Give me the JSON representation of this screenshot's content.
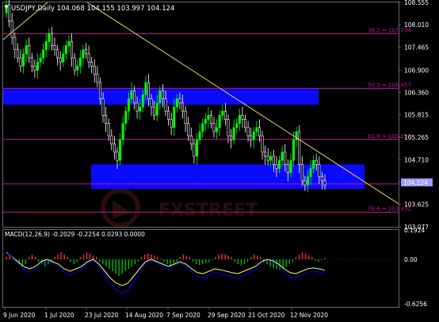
{
  "header": {
    "symbol_line": "USDJPY,Daily  104.068 104.155 103.997 104.124"
  },
  "price_axis": {
    "labels": [
      "108.555",
      "108.010",
      "107.465",
      "106.900",
      "106.360",
      "105.815",
      "105.265",
      "104.710",
      "104.170",
      "103.625",
      "103.077"
    ]
  },
  "current_price": "104.124",
  "macd_panel": {
    "title": "MACD(12,26,9) -0.2029 -0.2254 0.0293 0.0000",
    "axis_labels": [
      "0.1924",
      "0.00",
      "-0.6256"
    ]
  },
  "time_axis": {
    "labels": [
      "9 Jun 2020",
      "1 Jul 2020",
      "23 Jul 2020",
      "14 Aug 2020",
      "7 Sep 2020",
      "29 Sep 2020",
      "21 Oct 2020",
      "12 Nov 2020"
    ]
  },
  "fib_levels": [
    {
      "label": "38.2 = 107.794",
      "value": 107.794
    },
    {
      "label": "50.0 = 106.457",
      "value": 106.457
    },
    {
      "label": "61.8 = 105.211",
      "value": 105.211
    },
    {
      "label": "78.6 = 103.432",
      "value": 103.432
    }
  ],
  "zones": [
    {
      "name": "upper-zone",
      "from": 106.44,
      "to": 106.06
    },
    {
      "name": "lower-zone",
      "from": 104.6,
      "to": 104.0
    }
  ],
  "watermark": "FXSTREET",
  "colors": {
    "background": "#000000",
    "bull_candle": "#00ff00",
    "bear_candle": "#ffffff",
    "fib_line": "#c2179b",
    "zone": "#0a0aff",
    "trendline": "#e7d75a",
    "macd_pos": "#ff3030",
    "macd_neg": "#00c000",
    "signal_line": "#ffff60",
    "macd_line": "#0000ff",
    "axis_text": "#ffffff",
    "price_box": "#9a9aff"
  },
  "chart_data": {
    "type": "candlestick",
    "title": "USDJPY,Daily",
    "x": [
      "9 Jun 2020",
      "1 Jul 2020",
      "23 Jul 2020",
      "14 Aug 2020",
      "7 Sep 2020",
      "29 Sep 2020",
      "21 Oct 2020",
      "12 Nov 2020"
    ],
    "close_series": [
      108.5,
      108.1,
      107.7,
      107.4,
      107.2,
      107.0,
      107.3,
      107.5,
      107.2,
      107.0,
      106.9,
      107.1,
      107.2,
      107.4,
      107.6,
      107.8,
      107.5,
      107.4,
      107.2,
      107.1,
      107.3,
      107.5,
      107.6,
      107.2,
      106.9,
      107.0,
      107.2,
      107.4,
      107.3,
      107.1,
      107.0,
      106.8,
      106.6,
      106.2,
      105.8,
      105.6,
      105.3,
      105.1,
      104.9,
      104.7,
      105.2,
      105.6,
      105.9,
      106.2,
      106.4,
      106.1,
      105.9,
      106.0,
      106.3,
      106.6,
      106.2,
      106.0,
      105.8,
      106.1,
      106.4,
      106.2,
      105.9,
      105.7,
      105.5,
      106.0,
      106.2,
      106.1,
      105.9,
      105.6,
      105.3,
      105.1,
      104.8,
      105.2,
      105.4,
      105.6,
      105.7,
      105.8,
      105.6,
      105.4,
      105.5,
      105.8,
      105.9,
      105.7,
      105.3,
      105.2,
      105.5,
      105.6,
      105.8,
      105.7,
      105.5,
      105.3,
      105.2,
      105.4,
      105.5,
      105.3,
      104.9,
      104.8,
      104.7,
      104.8,
      104.6,
      104.5,
      104.7,
      104.9,
      104.6,
      104.4,
      104.7,
      105.2,
      105.4,
      104.6,
      104.2,
      104.1,
      104.3,
      104.5,
      104.7,
      104.6,
      104.3,
      104.2,
      104.1
    ],
    "macd_hist_values": [
      0.05,
      0.1,
      0.05,
      -0.05,
      -0.1,
      -0.15,
      -0.1,
      0.05,
      0.1,
      0.05,
      -0.05,
      -0.1,
      -0.15,
      -0.1,
      -0.05,
      0.05,
      0.1,
      0.15,
      0.1,
      0.05,
      -0.05,
      -0.1,
      -0.05,
      0.05,
      0.1,
      0.15,
      0.12,
      0.08,
      0.05,
      -0.05,
      -0.1,
      -0.15,
      -0.2,
      -0.25,
      -0.3,
      -0.35,
      -0.3,
      -0.25,
      -0.2,
      -0.15,
      -0.1,
      -0.05,
      0.05,
      0.1,
      0.12,
      0.1,
      0.08,
      0.05,
      0.02,
      -0.05,
      -0.1,
      -0.15,
      -0.1,
      -0.05,
      0.05,
      0.1,
      0.08,
      0.05,
      -0.05,
      -0.1,
      -0.12,
      -0.1,
      -0.08,
      -0.05,
      -0.02,
      0.05,
      0.1,
      0.12,
      0.1,
      0.08,
      0.05,
      -0.05,
      -0.1,
      -0.12,
      -0.1,
      -0.05,
      0.05,
      0.1,
      0.08,
      0.05,
      -0.05,
      -0.1,
      -0.15,
      -0.18,
      -0.2,
      -0.22,
      -0.2,
      -0.15,
      -0.1,
      -0.05,
      0.05,
      0.1,
      0.15,
      0.12,
      0.08,
      0.05,
      -0.03,
      -0.05,
      -0.02,
      0.03
    ],
    "signal_line_values": [
      0.15,
      0.05,
      -0.05,
      -0.15,
      -0.2,
      -0.15,
      -0.05,
      0.0,
      -0.05,
      -0.1,
      -0.2,
      -0.25,
      -0.2,
      -0.15,
      -0.05,
      0.0,
      -0.1,
      -0.25,
      -0.4,
      -0.5,
      -0.55,
      -0.5,
      -0.35,
      -0.2,
      -0.05,
      0.0,
      -0.05,
      -0.1,
      -0.15,
      -0.1,
      -0.05,
      -0.1,
      -0.2,
      -0.28,
      -0.3,
      -0.25,
      -0.2,
      -0.22,
      -0.25,
      -0.28,
      -0.3,
      -0.25,
      -0.2,
      -0.15,
      -0.05,
      0.0,
      -0.03,
      -0.1,
      -0.2,
      -0.28,
      -0.3,
      -0.25,
      -0.2,
      -0.18,
      -0.2,
      -0.23
    ],
    "ylim": [
      103.077,
      108.555
    ]
  }
}
